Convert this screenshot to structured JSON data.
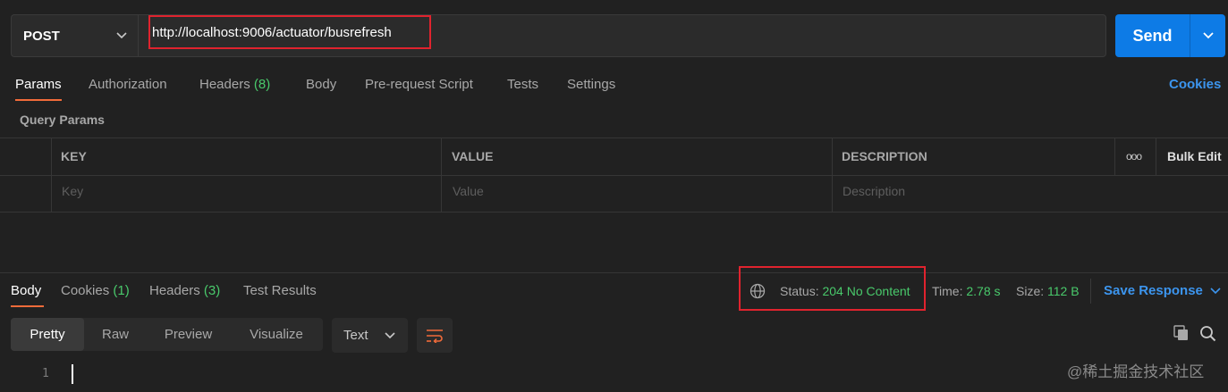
{
  "request": {
    "method": "POST",
    "url": "http://localhost:9006/actuator/busrefresh",
    "send_label": "Send"
  },
  "request_tabs": [
    {
      "label": "Params",
      "count": ""
    },
    {
      "label": "Authorization",
      "count": ""
    },
    {
      "label": "Headers",
      "count": "(8)"
    },
    {
      "label": "Body",
      "count": ""
    },
    {
      "label": "Pre-request Script",
      "count": ""
    },
    {
      "label": "Tests",
      "count": ""
    },
    {
      "label": "Settings",
      "count": ""
    }
  ],
  "cookies_link": "Cookies",
  "query_params": {
    "title": "Query Params",
    "columns": [
      "KEY",
      "VALUE",
      "DESCRIPTION"
    ],
    "placeholders": [
      "Key",
      "Value",
      "Description"
    ],
    "more_label": "ooo",
    "bulk_edit": "Bulk Edit"
  },
  "response": {
    "tabs": [
      {
        "label": "Body",
        "count": ""
      },
      {
        "label": "Cookies",
        "count": "(1)"
      },
      {
        "label": "Headers",
        "count": "(3)"
      },
      {
        "label": "Test Results",
        "count": ""
      }
    ],
    "status_label": "Status:",
    "status_value": "204 No Content",
    "time_label": "Time:",
    "time_value": "2.78 s",
    "size_label": "Size:",
    "size_value": "112 B",
    "save_response": "Save Response",
    "view_modes": [
      "Pretty",
      "Raw",
      "Preview",
      "Visualize"
    ],
    "format": "Text",
    "line_number": "1"
  },
  "watermark": "@稀土掘金技术社区",
  "colors": {
    "accent": "#0d7be6",
    "link": "#3c95ee",
    "success": "#49c96b",
    "tab_underline": "#f26b3a",
    "highlight_box": "#e0232e"
  }
}
